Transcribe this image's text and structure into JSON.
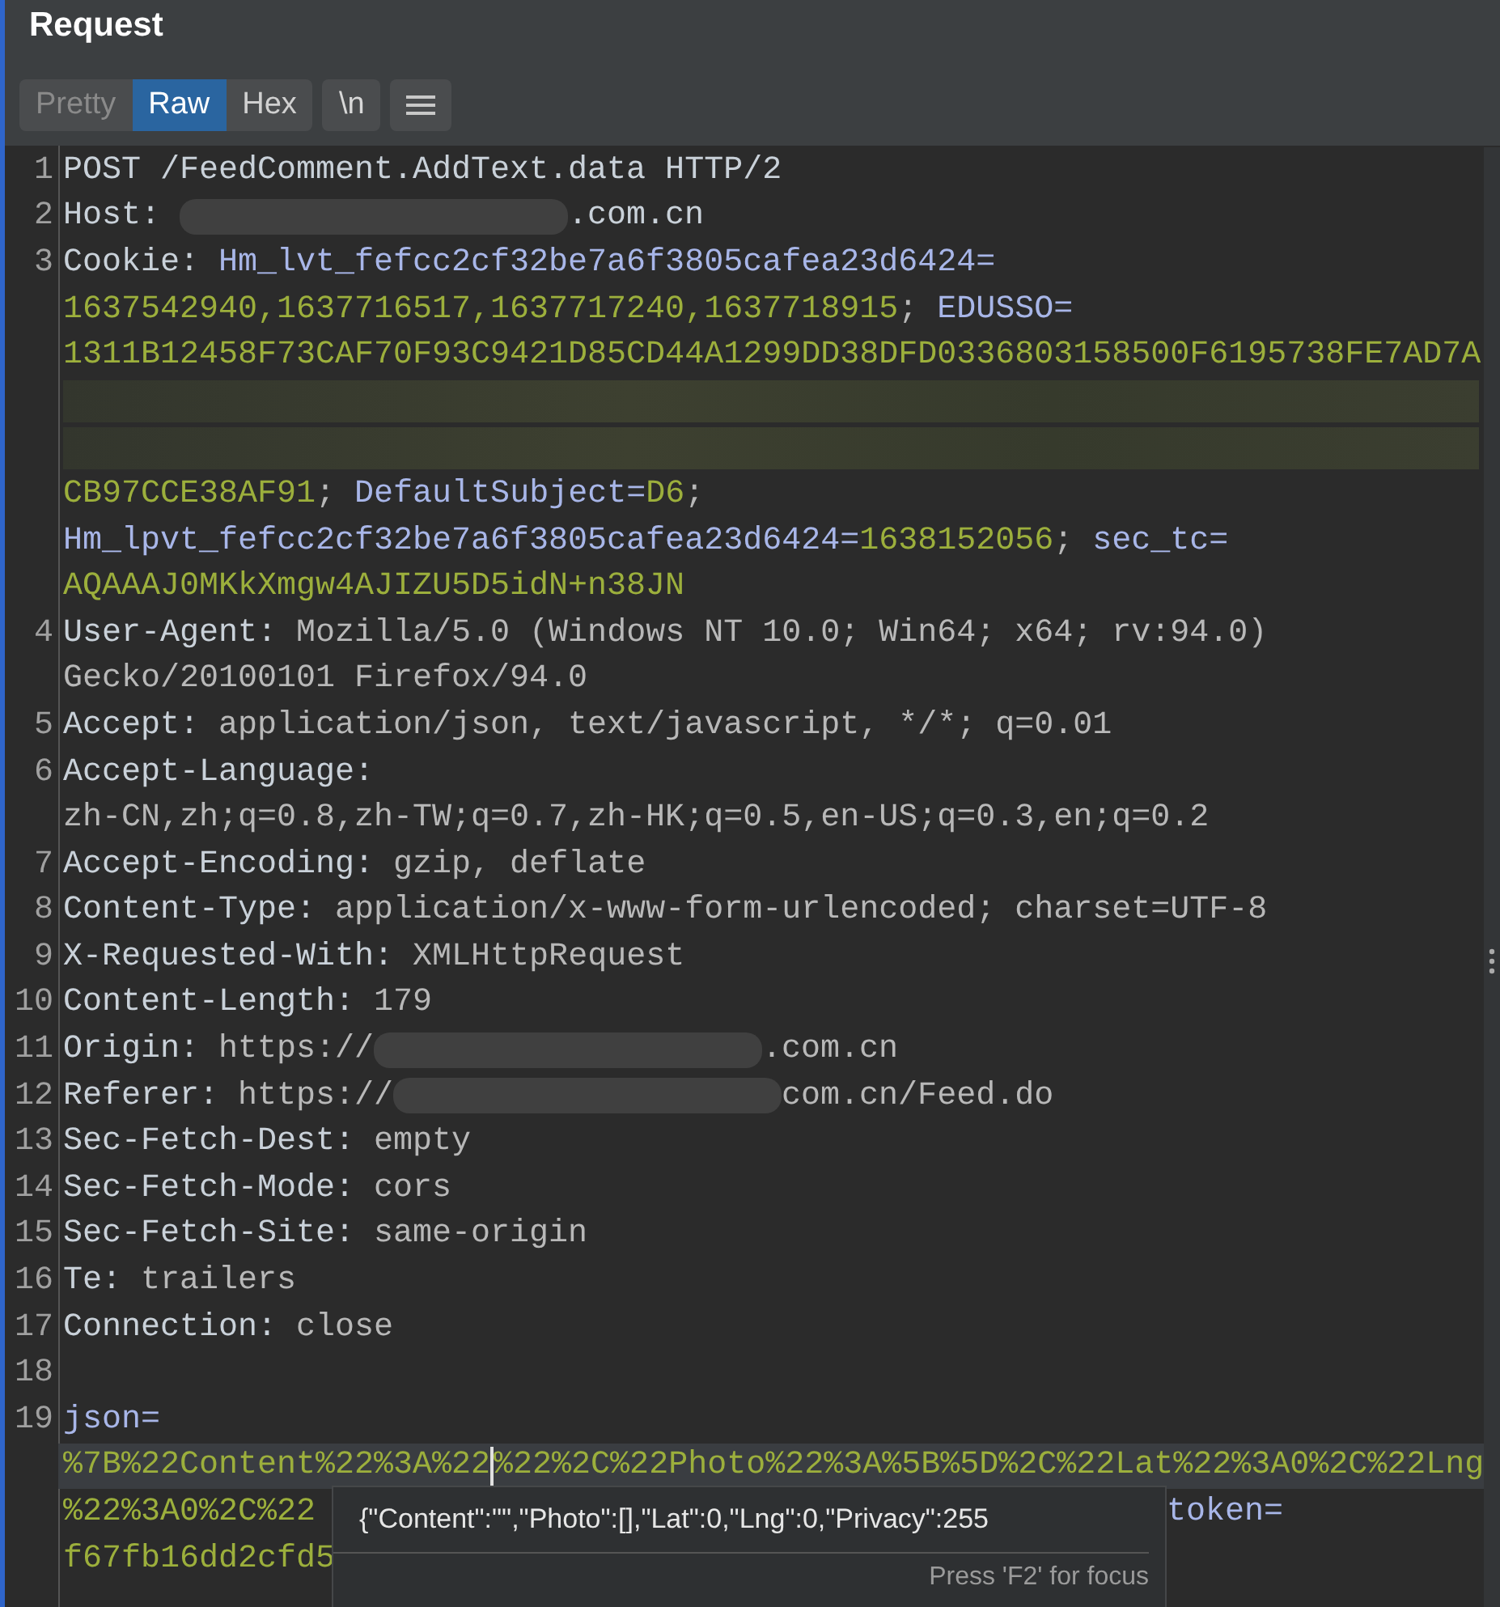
{
  "panel": {
    "title": "Request"
  },
  "view_tabs": [
    {
      "label": "Pretty",
      "selected": false,
      "disabled": true
    },
    {
      "label": "Raw",
      "selected": true,
      "disabled": false
    },
    {
      "label": "Hex",
      "selected": false,
      "disabled": false
    }
  ],
  "buttons": [
    {
      "kind": "text",
      "label": "\\n"
    },
    {
      "kind": "menu"
    }
  ],
  "lines": [
    {
      "number": "1",
      "rows": [
        {
          "highlighted": false,
          "segments": [
            {
              "kind": "name",
              "text": "POST /FeedComment.AddText.data HTTP/2"
            }
          ]
        }
      ]
    },
    {
      "number": "2",
      "rows": [
        {
          "highlighted": false,
          "segments": [
            {
              "kind": "name",
              "text": "Host: "
            },
            {
              "kind": "redacted"
            },
            {
              "kind": "name",
              "text": ".com.cn"
            }
          ]
        }
      ]
    },
    {
      "number": "3",
      "rows": [
        {
          "highlighted": false,
          "segments": [
            {
              "kind": "name",
              "text": "Cookie: "
            },
            {
              "kind": "cookie-name",
              "text": "Hm_lvt_fefcc2cf32be7a6f3805cafea23d6424="
            }
          ]
        },
        {
          "highlighted": false,
          "segments": [
            {
              "kind": "cookie-value",
              "text": "1637542940,1637716517,1637717240,1637718915"
            },
            {
              "kind": "sep",
              "text": "; "
            },
            {
              "kind": "cookie-name",
              "text": "EDUSSO="
            }
          ]
        },
        {
          "highlighted": false,
          "segments": [
            {
              "kind": "cookie-value",
              "text": "1311B12458F73CAF70F93C9421D85CD44A1299DD38DFD0336803158500F6195738FE7AD7A"
            }
          ]
        },
        {
          "highlighted": false,
          "segments": [
            {
              "kind": "redacted-row"
            }
          ]
        },
        {
          "highlighted": false,
          "segments": [
            {
              "kind": "redacted-row"
            }
          ]
        },
        {
          "highlighted": false,
          "segments": [
            {
              "kind": "cookie-value",
              "text": "CB97CCE38AF91"
            },
            {
              "kind": "sep",
              "text": "; "
            },
            {
              "kind": "cookie-name",
              "text": "DefaultSubject="
            },
            {
              "kind": "cookie-value",
              "text": "D6"
            },
            {
              "kind": "sep",
              "text": ";"
            }
          ]
        },
        {
          "highlighted": false,
          "segments": [
            {
              "kind": "cookie-name",
              "text": "Hm_lpvt_fefcc2cf32be7a6f3805cafea23d6424="
            },
            {
              "kind": "cookie-value",
              "text": "1638152056"
            },
            {
              "kind": "sep",
              "text": "; "
            },
            {
              "kind": "cookie-name",
              "text": "sec_tc="
            }
          ]
        },
        {
          "highlighted": false,
          "segments": [
            {
              "kind": "cookie-value",
              "text": "AQAAAJ0MKkXmgw4AJIZU5D5idN+n38JN"
            }
          ]
        }
      ]
    },
    {
      "number": "4",
      "rows": [
        {
          "highlighted": false,
          "segments": [
            {
              "kind": "name",
              "text": "User-Agent: "
            },
            {
              "kind": "value",
              "text": "Mozilla/5.0 (Windows NT 10.0; Win64; x64; rv:94.0)"
            }
          ]
        },
        {
          "highlighted": false,
          "segments": [
            {
              "kind": "value",
              "text": "Gecko/20100101 Firefox/94.0"
            }
          ]
        }
      ]
    },
    {
      "number": "5",
      "rows": [
        {
          "highlighted": false,
          "segments": [
            {
              "kind": "name",
              "text": "Accept: "
            },
            {
              "kind": "value",
              "text": "application/json, text/javascript, */*; q=0.01"
            }
          ]
        }
      ]
    },
    {
      "number": "6",
      "rows": [
        {
          "highlighted": false,
          "segments": [
            {
              "kind": "name",
              "text": "Accept-Language:"
            }
          ]
        },
        {
          "highlighted": false,
          "segments": [
            {
              "kind": "value",
              "text": "zh-CN,zh;q=0.8,zh-TW;q=0.7,zh-HK;q=0.5,en-US;q=0.3,en;q=0.2"
            }
          ]
        }
      ]
    },
    {
      "number": "7",
      "rows": [
        {
          "highlighted": false,
          "segments": [
            {
              "kind": "name",
              "text": "Accept-Encoding: "
            },
            {
              "kind": "value",
              "text": "gzip, deflate"
            }
          ]
        }
      ]
    },
    {
      "number": "8",
      "rows": [
        {
          "highlighted": false,
          "segments": [
            {
              "kind": "name",
              "text": "Content-Type: "
            },
            {
              "kind": "value",
              "text": "application/x-www-form-urlencoded; charset=UTF-8"
            }
          ]
        }
      ]
    },
    {
      "number": "9",
      "rows": [
        {
          "highlighted": false,
          "segments": [
            {
              "kind": "name",
              "text": "X-Requested-With: "
            },
            {
              "kind": "value",
              "text": "XMLHttpRequest"
            }
          ]
        }
      ]
    },
    {
      "number": "10",
      "rows": [
        {
          "highlighted": false,
          "segments": [
            {
              "kind": "name",
              "text": "Content-Length: "
            },
            {
              "kind": "value",
              "text": "179"
            }
          ]
        }
      ]
    },
    {
      "number": "11",
      "rows": [
        {
          "highlighted": false,
          "segments": [
            {
              "kind": "name",
              "text": "Origin: "
            },
            {
              "kind": "value",
              "text": "https://"
            },
            {
              "kind": "redacted"
            },
            {
              "kind": "value",
              "text": ".com.cn"
            }
          ]
        }
      ]
    },
    {
      "number": "12",
      "rows": [
        {
          "highlighted": false,
          "segments": [
            {
              "kind": "name",
              "text": "Referer: "
            },
            {
              "kind": "value",
              "text": "https://"
            },
            {
              "kind": "redacted"
            },
            {
              "kind": "value",
              "text": "com.cn/Feed.do"
            }
          ]
        }
      ]
    },
    {
      "number": "13",
      "rows": [
        {
          "highlighted": false,
          "segments": [
            {
              "kind": "name",
              "text": "Sec-Fetch-Dest: "
            },
            {
              "kind": "value",
              "text": "empty"
            }
          ]
        }
      ]
    },
    {
      "number": "14",
      "rows": [
        {
          "highlighted": false,
          "segments": [
            {
              "kind": "name",
              "text": "Sec-Fetch-Mode: "
            },
            {
              "kind": "value",
              "text": "cors"
            }
          ]
        }
      ]
    },
    {
      "number": "15",
      "rows": [
        {
          "highlighted": false,
          "segments": [
            {
              "kind": "name",
              "text": "Sec-Fetch-Site: "
            },
            {
              "kind": "value",
              "text": "same-origin"
            }
          ]
        }
      ]
    },
    {
      "number": "16",
      "rows": [
        {
          "highlighted": false,
          "segments": [
            {
              "kind": "name",
              "text": "Te: "
            },
            {
              "kind": "value",
              "text": "trailers"
            }
          ]
        }
      ]
    },
    {
      "number": "17",
      "rows": [
        {
          "highlighted": false,
          "segments": [
            {
              "kind": "name",
              "text": "Connection: "
            },
            {
              "kind": "value",
              "text": "close"
            }
          ]
        }
      ]
    },
    {
      "number": "18",
      "rows": [
        {
          "highlighted": false,
          "segments": []
        }
      ]
    },
    {
      "number": "19",
      "rows": [
        {
          "highlighted": false,
          "segments": [
            {
              "kind": "param-name",
              "text": "json="
            }
          ]
        },
        {
          "highlighted": true,
          "segments": [
            {
              "kind": "param-value",
              "text": "%7B%22Content%22%3A%22"
            },
            {
              "kind": "caret"
            },
            {
              "kind": "param-value",
              "text": "%22%2C%22Photo%22%3A%5B%5D%2C%22Lat%22%3A0%2C%22Lng"
            }
          ]
        },
        {
          "highlighted": false,
          "segments": [
            {
              "kind": "param-value",
              "text": "%22%3A0%2C%22"
            },
            {
              "kind": "covered"
            },
            {
              "kind": "param-name",
              "text": "token="
            }
          ]
        },
        {
          "highlighted": false,
          "segments": [
            {
              "kind": "param-value",
              "text": "f67fb16dd2cfd5"
            }
          ]
        }
      ]
    }
  ],
  "tooltip": {
    "text": "{\"Content\":\"\",\"Photo\":[],\"Lat\":0,\"Lng\":0,\"Privacy\":255",
    "hint": "Press 'F2' for focus"
  }
}
